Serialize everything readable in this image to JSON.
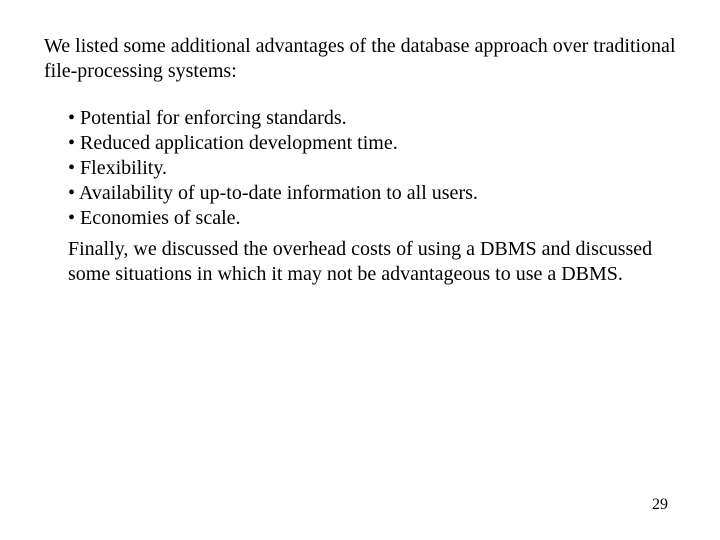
{
  "intro": "We listed some additional advantages of the database approach over traditional file-processing systems:",
  "bullets": {
    "b0": "Potential for enforcing standards.",
    "b1": "Reduced application development time.",
    "b2": "Flexibility.",
    "b3": "Availability of up-to-date information to all users.",
    "b4": "Economies of scale."
  },
  "closing": "Finally, we discussed the overhead costs of using a DBMS and discussed some situations in which it may not be advantageous to use a DBMS.",
  "page_number": "29"
}
